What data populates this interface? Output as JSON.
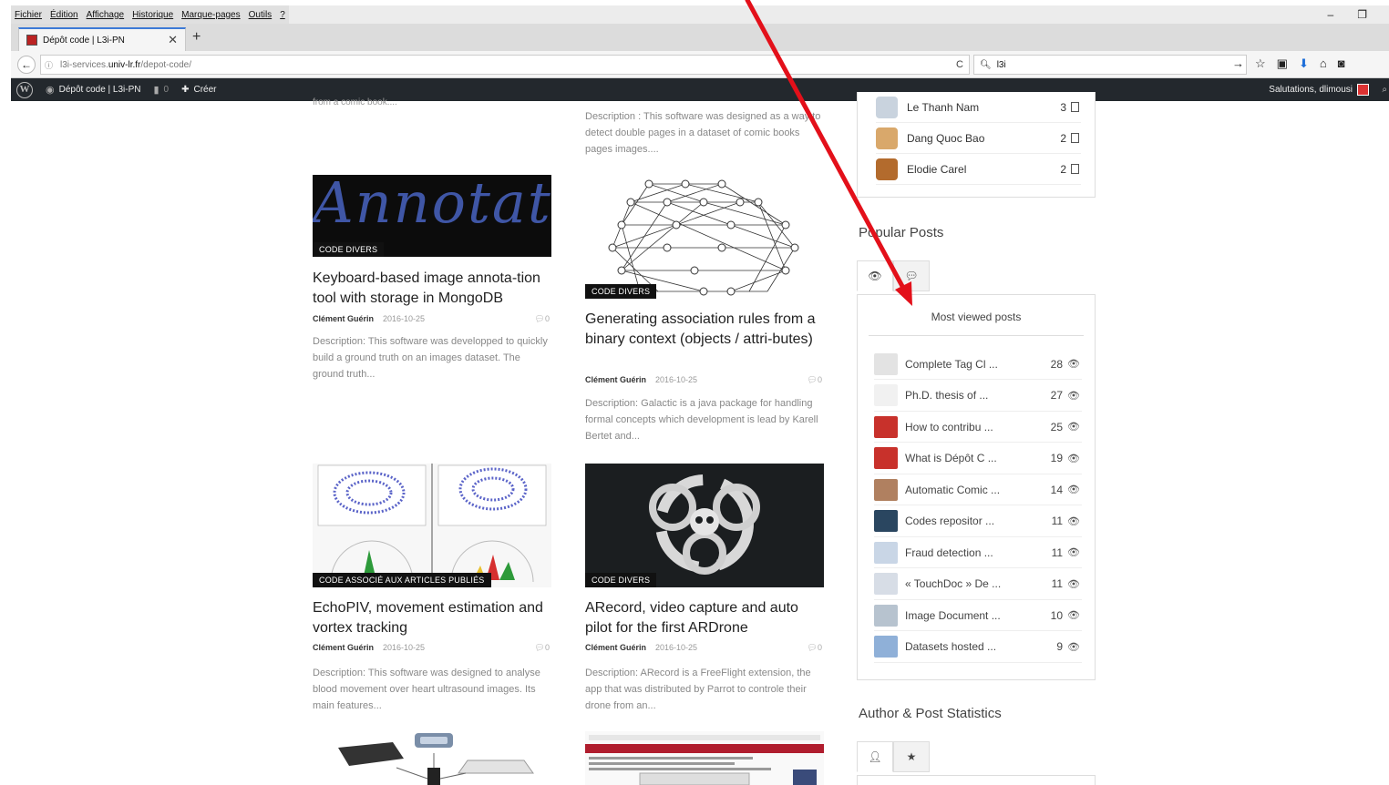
{
  "browser": {
    "menu": [
      "Fichier",
      "Édition",
      "Affichage",
      "Historique",
      "Marque-pages",
      "Outils",
      "?"
    ],
    "minimize": "–",
    "restore": "❐",
    "tab_title": "Dépôt code | L3i-PN",
    "tab_close": "✕",
    "new_tab": "+",
    "url_prefix": "l3i-services.",
    "url_domain": "univ-lr.fr",
    "url_path": "/depot-code/",
    "reload": "C",
    "search_value": "l3i"
  },
  "adminbar": {
    "site_name": "Dépôt code | L3i-PN",
    "comments_count": "0",
    "create_label": "Créer",
    "greeting": "Salutations, dlimousi"
  },
  "content": {
    "top_fragment_left": "from a comic book....",
    "top_fragment_right": "Description : This software was designed as a way to detect double pages in a dataset of comic books pages images....",
    "cards": [
      {
        "category": "CODE DIVERS",
        "thumb_text": "Annotat",
        "title": "Keyboard-based image annota-tion tool with storage in MongoDB",
        "author": "Clément Guérin",
        "date": "2016-10-25",
        "comments": "0",
        "description": "Description: This software was developped to quickly build a ground truth on an images dataset. The ground truth..."
      },
      {
        "category": "CODE DIVERS",
        "title": "Generating association rules from a binary context (objects / attri-butes)",
        "author": "Clément Guérin",
        "date": "2016-10-25",
        "comments": "0",
        "description": "Description: Galactic is a java package for handling formal concepts which development is lead by Karell Bertet and..."
      },
      {
        "category": "CODE ASSOCIÉ AUX ARTICLES PUBLIÉS",
        "title": "EchoPIV, movement estimation and vortex tracking",
        "author": "Clément Guérin",
        "date": "2016-10-25",
        "comments": "0",
        "description": "Description: This software was designed to analyse blood movement over heart ultrasound images. Its main features..."
      },
      {
        "category": "CODE DIVERS",
        "title": "ARecord, video capture and auto pilot for the first ARDrone",
        "author": "Clément Guérin",
        "date": "2016-10-25",
        "comments": "0",
        "description": "Description: ARecord is a FreeFlight extension, the app that was distributed by Parrot to controle their drone from an..."
      }
    ]
  },
  "sidebar": {
    "authors": [
      {
        "name": "Le Thanh Nam",
        "count": "3"
      },
      {
        "name": "Dang Quoc Bao",
        "count": "2"
      },
      {
        "name": "Elodie Carel",
        "count": "2"
      }
    ],
    "popular_title": "Popular Posts",
    "most_viewed_heading": "Most viewed posts",
    "popular_posts": [
      {
        "title": "Complete Tag Cl ...",
        "views": "28",
        "thumb_color": "#e3e3e3"
      },
      {
        "title": "Ph.D. thesis of ...",
        "views": "27",
        "thumb_color": "#f1f1f1"
      },
      {
        "title": "How to contribu ...",
        "views": "25",
        "thumb_color": "#c8312b"
      },
      {
        "title": "What is Dépôt C ...",
        "views": "19",
        "thumb_color": "#c8312b"
      },
      {
        "title": "Automatic Comic ...",
        "views": "14",
        "thumb_color": "#b08060"
      },
      {
        "title": "Codes repositor ...",
        "views": "11",
        "thumb_color": "#2a4660"
      },
      {
        "title": "Fraud detection ...",
        "views": "11",
        "thumb_color": "#c9d6e6"
      },
      {
        "title": "« TouchDoc » De ...",
        "views": "11",
        "thumb_color": "#d7dde6"
      },
      {
        "title": "Image Document ...",
        "views": "10",
        "thumb_color": "#b7c3cf"
      },
      {
        "title": "Datasets hosted ...",
        "views": "9",
        "thumb_color": "#8fb0d8"
      }
    ],
    "stats_title": "Author & Post Statistics"
  },
  "colors": {
    "annotation_arrow": "#e3101a",
    "admin_bar": "#23282d"
  }
}
